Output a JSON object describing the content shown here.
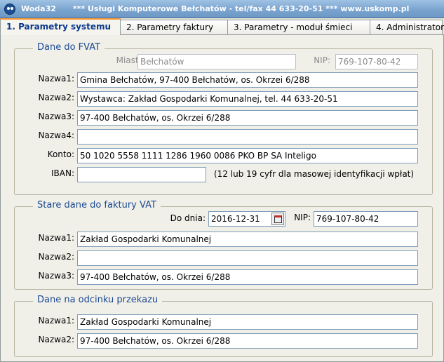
{
  "window": {
    "app_name": "Woda32",
    "title_text": "*** Usługi Komputerowe Bełchatów - tel/fax  44 633-20-51  ***  www.uskomp.pl"
  },
  "tabs": [
    {
      "label": "1. Parametry systemu",
      "active": true
    },
    {
      "label": "2. Parametry faktury",
      "active": false
    },
    {
      "label": "3. Parametry - moduł śmieci",
      "active": false
    },
    {
      "label": "4. Administrator",
      "active": false
    }
  ],
  "fvat": {
    "legend": "Dane do FVAT",
    "miasto_label": "Miasto:",
    "miasto_value": "Bełchatów",
    "nip_label": "NIP:",
    "nip_value": "769-107-80-42",
    "nazwa1_label": "Nazwa1:",
    "nazwa1_value": "Gmina Bełchatów, 97-400 Bełchatów, os. Okrzei 6/288",
    "nazwa2_label": "Nazwa2:",
    "nazwa2_value": "Wystawca: Zakład Gospodarki Komunalnej, tel. 44 633-20-51",
    "nazwa3_label": "Nazwa3:",
    "nazwa3_value": "97-400 Bełchatów, os. Okrzei 6/288",
    "nazwa4_label": "Nazwa4:",
    "nazwa4_value": "",
    "konto_label": "Konto:",
    "konto_value": "50 1020 5558 1111 1286 1960 0086 PKO BP SA Inteligo",
    "iban_label": "IBAN:",
    "iban_value": "",
    "iban_note": "(12 lub 19 cyfr dla masowej identyfikacji wpłat)"
  },
  "stare": {
    "legend": "Stare dane do faktury VAT",
    "dodnia_label": "Do dnia:",
    "dodnia_value": "2016-12-31",
    "nip_label": "NIP:",
    "nip_value": "769-107-80-42",
    "nazwa1_label": "Nazwa1:",
    "nazwa1_value": "Zakład Gospodarki Komunalnej",
    "nazwa2_label": "Nazwa2:",
    "nazwa2_value": "",
    "nazwa3_label": "Nazwa3:",
    "nazwa3_value": "97-400 Bełchatów, os. Okrzei 6/288"
  },
  "odcinek": {
    "legend": "Dane na odcinku przekazu",
    "nazwa1_label": "Nazwa1:",
    "nazwa1_value": "Zakład Gospodarki Komunalnej",
    "nazwa2_label": "Nazwa2:",
    "nazwa2_value": "97-400 Bełchatów, os. Okrzei 6/288"
  },
  "icons": {
    "app": "app-icon",
    "date_picker": "calendar-icon"
  }
}
